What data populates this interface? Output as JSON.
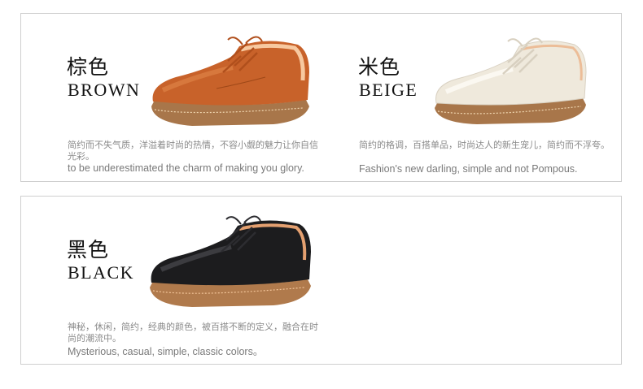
{
  "variants": {
    "brown": {
      "title_cn": "棕色",
      "title_en": "BROWN",
      "desc_cn": "简约而不失气质，洋溢着时尚的热情，不容小觑的魅力让你自信光彩。",
      "desc_en": "to be underestimated the charm of making you glory.",
      "upper_color": "#c8622a",
      "upper_highlight": "#e48a4c",
      "sole_color": "#a8764a"
    },
    "beige": {
      "title_cn": "米色",
      "title_en": "BEIGE",
      "desc_cn": "简约的格调，百搭单品，时尚达人的新生宠儿，简约而不浮夸。",
      "desc_en": "Fashion's new darling, simple and not Pompous.",
      "upper_color": "#efe9dc",
      "upper_highlight": "#fbf8f1",
      "sole_color": "#a8764a"
    },
    "black": {
      "title_cn": "黑色",
      "title_en": "BLACK",
      "desc_cn": "神秘，休闲，简约，经典的颜色，被百搭不断的定义，融合在时尚的潮流中。",
      "desc_en": "Mysterious, casual, simple, classic colors。",
      "upper_color": "#1c1c1e",
      "upper_highlight": "#4a4a4e",
      "sole_color": "#b07a4c"
    }
  }
}
